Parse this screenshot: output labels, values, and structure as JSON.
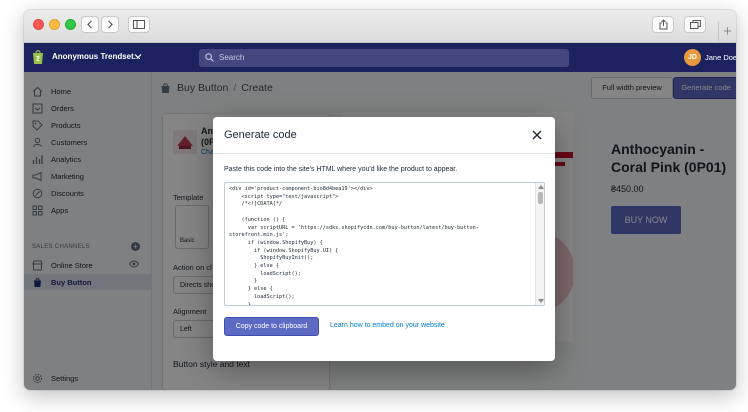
{
  "topbar": {
    "store_name": "Anonymous Trendset...",
    "search_placeholder": "Search",
    "avatar_initials": "JD",
    "user_name": "Jane Doe"
  },
  "sidebar": {
    "items": [
      {
        "label": "Home",
        "icon": "home-icon"
      },
      {
        "label": "Orders",
        "icon": "orders-icon"
      },
      {
        "label": "Products",
        "icon": "tag-icon"
      },
      {
        "label": "Customers",
        "icon": "customers-icon"
      },
      {
        "label": "Analytics",
        "icon": "analytics-icon"
      },
      {
        "label": "Marketing",
        "icon": "marketing-icon"
      },
      {
        "label": "Discounts",
        "icon": "discount-icon"
      },
      {
        "label": "Apps",
        "icon": "apps-icon"
      }
    ],
    "section_header": "SALES CHANNELS",
    "channels": [
      {
        "label": "Online Store"
      },
      {
        "label": "Buy Button",
        "active": true
      }
    ],
    "settings_label": "Settings"
  },
  "page": {
    "breadcrumb_parent": "Buy Button",
    "breadcrumb_separator": "/",
    "breadcrumb_current": "Create",
    "full_width_preview_label": "Full width preview",
    "generate_code_label": "Generate code"
  },
  "builder": {
    "product_name_line1": "Ant",
    "product_name_line2": "(0P",
    "change_link": "Cha",
    "template_label": "Template",
    "template_tile": "Basic",
    "action_label": "Action on cl",
    "action_value": "Directs sho",
    "alignment_label": "Alignment",
    "alignment_value": "Left",
    "button_style_label": "Button style and text"
  },
  "preview": {
    "title": "Anthocyanin - Coral Pink (0P01)",
    "price": "₴450.00",
    "buy_label": "BUY NOW"
  },
  "modal": {
    "title": "Generate code",
    "description": "Paste this code into the site's HTML where you'd like the product to appear.",
    "code": "<div id='product-component-bio8d4bea19'></div>\n    <script type=\"text/javascript\">\n    /*<![CDATA[*/\n\n    (function () {\n      var scriptURL = 'https://sdks.shopifycdn.com/buy-button/latest/buy-button-\nstorefront.min.js';\n      if (window.ShopifyBuy) {\n        if (window.ShopifyBuy.UI) {\n          ShopifyBuyInit();\n        } else {\n          loadScript();\n        }\n      } else {\n        loadScript();\n      }",
    "copy_label": "Copy code to clipboard",
    "learn_label": "Learn how to embed on your website"
  },
  "colors": {
    "topbar": "#1c2260",
    "primary_button": "#5c6ac4",
    "link": "#007ace",
    "avatar": "#e8993e"
  }
}
